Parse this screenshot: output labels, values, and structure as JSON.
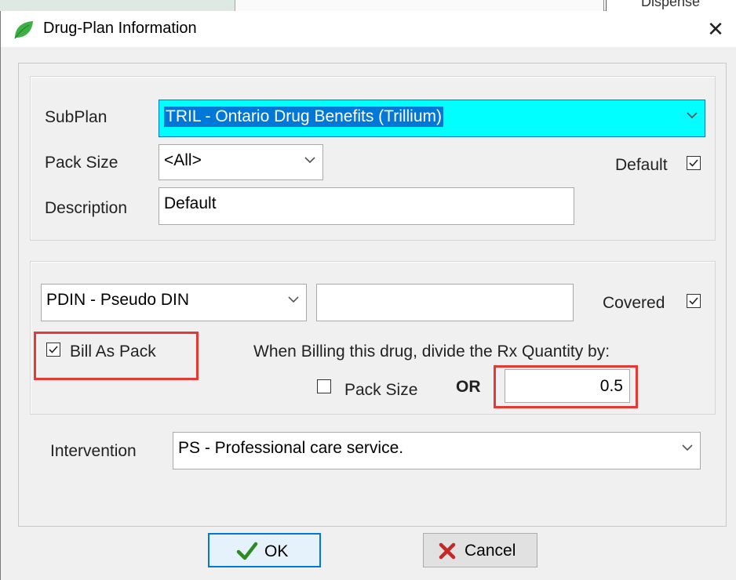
{
  "background": {
    "tab_fragment": "Dispense"
  },
  "dialog": {
    "title": "Drug-Plan Information",
    "icons": {
      "app": "leaf-icon",
      "close": "close-icon"
    }
  },
  "plan_group": {
    "subplan_label": "SubPlan",
    "subplan_value": "TRIL - Ontario Drug Benefits (Trillium)",
    "pack_size_label": "Pack Size",
    "pack_size_value": "<All>",
    "default_label": "Default",
    "default_checked": true,
    "description_label": "Description",
    "description_value": "Default"
  },
  "billing_group": {
    "din_type_value": "PDIN - Pseudo DIN",
    "din_value": "",
    "covered_label": "Covered",
    "covered_checked": true,
    "bill_as_pack_label": "Bill As Pack",
    "bill_as_pack_checked": true,
    "instruction": "When Billing this drug, divide the Rx Quantity by:",
    "pack_size_option_label": "Pack Size",
    "pack_size_option_checked": false,
    "or_label": "OR",
    "divisor_value": "0.5"
  },
  "intervention": {
    "label": "Intervention",
    "value": "PS - Professional care service."
  },
  "buttons": {
    "ok_label": "OK",
    "cancel_label": "Cancel"
  },
  "colors": {
    "accent": "#0078d7",
    "highlight_fill": "#00ffff",
    "annotation": "#e53935",
    "ok_check": "#2e8b22",
    "cancel_x": "#c62828",
    "leaf": "#3cb043"
  }
}
